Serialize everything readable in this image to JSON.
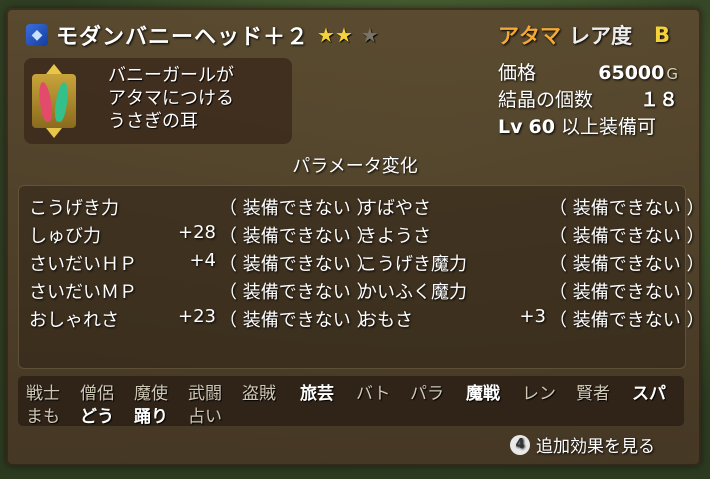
{
  "item": {
    "name": "モダンバニーヘッド＋２",
    "stars_filled": "★★",
    "stars_empty": "★",
    "slot": "アタマ",
    "rarity_label": "レア度",
    "rarity_grade": "B",
    "description": [
      "バニーガールが",
      "アタマにつける",
      "うさぎの耳"
    ]
  },
  "info": {
    "price_label": "価格",
    "price_value": "65000",
    "price_unit": "G",
    "crystal_label": "結晶の個数",
    "crystal_value": "１８",
    "lv_tag": "Lv",
    "lv_value": "60",
    "lv_suffix": "以上装備可"
  },
  "section_title": "パラメータ変化",
  "stats": {
    "left": [
      {
        "name": "こうげき力",
        "value": "",
        "state": "（  装備できない  ）"
      },
      {
        "name": "しゅび力",
        "value": "+28",
        "state": "（  装備できない  ）"
      },
      {
        "name": "さいだいＨＰ",
        "value": "+4",
        "state": "（  装備できない  ）"
      },
      {
        "name": "さいだいＭＰ",
        "value": "",
        "state": "（  装備できない  ）"
      },
      {
        "name": "おしゃれさ",
        "value": "+23",
        "state": "（  装備できない  ）"
      }
    ],
    "right": [
      {
        "name": "すばやさ",
        "value": "",
        "state": "（  装備できない  ）"
      },
      {
        "name": "きようさ",
        "value": "",
        "state": "（  装備できない  ）"
      },
      {
        "name": "こうげき魔力",
        "value": "",
        "state": "（  装備できない  ）"
      },
      {
        "name": "かいふく魔力",
        "value": "",
        "state": "（  装備できない  ）"
      },
      {
        "name": "おもさ",
        "value": "+3",
        "state": "（  装備できない  ）"
      }
    ]
  },
  "jobs": {
    "row1": [
      "戦士",
      "僧侶",
      "魔使",
      "武闘",
      "盗賊",
      "旅芸",
      "バト",
      "パラ",
      "魔戦",
      "レン",
      "賢者",
      "スパ"
    ],
    "row2": [
      "まも",
      "どう",
      "踊り",
      "占い"
    ],
    "row1_on": [
      false,
      false,
      false,
      false,
      false,
      true,
      false,
      false,
      true,
      false,
      false,
      true
    ],
    "row2_on": [
      false,
      true,
      true,
      false
    ]
  },
  "footer": {
    "button_glyph": "4",
    "more_label": "追加効果を見る"
  },
  "colors": {
    "slot_orange": "#f3a838",
    "star_gold": "#f5d23a",
    "panel_brown": "#5c4a30"
  }
}
